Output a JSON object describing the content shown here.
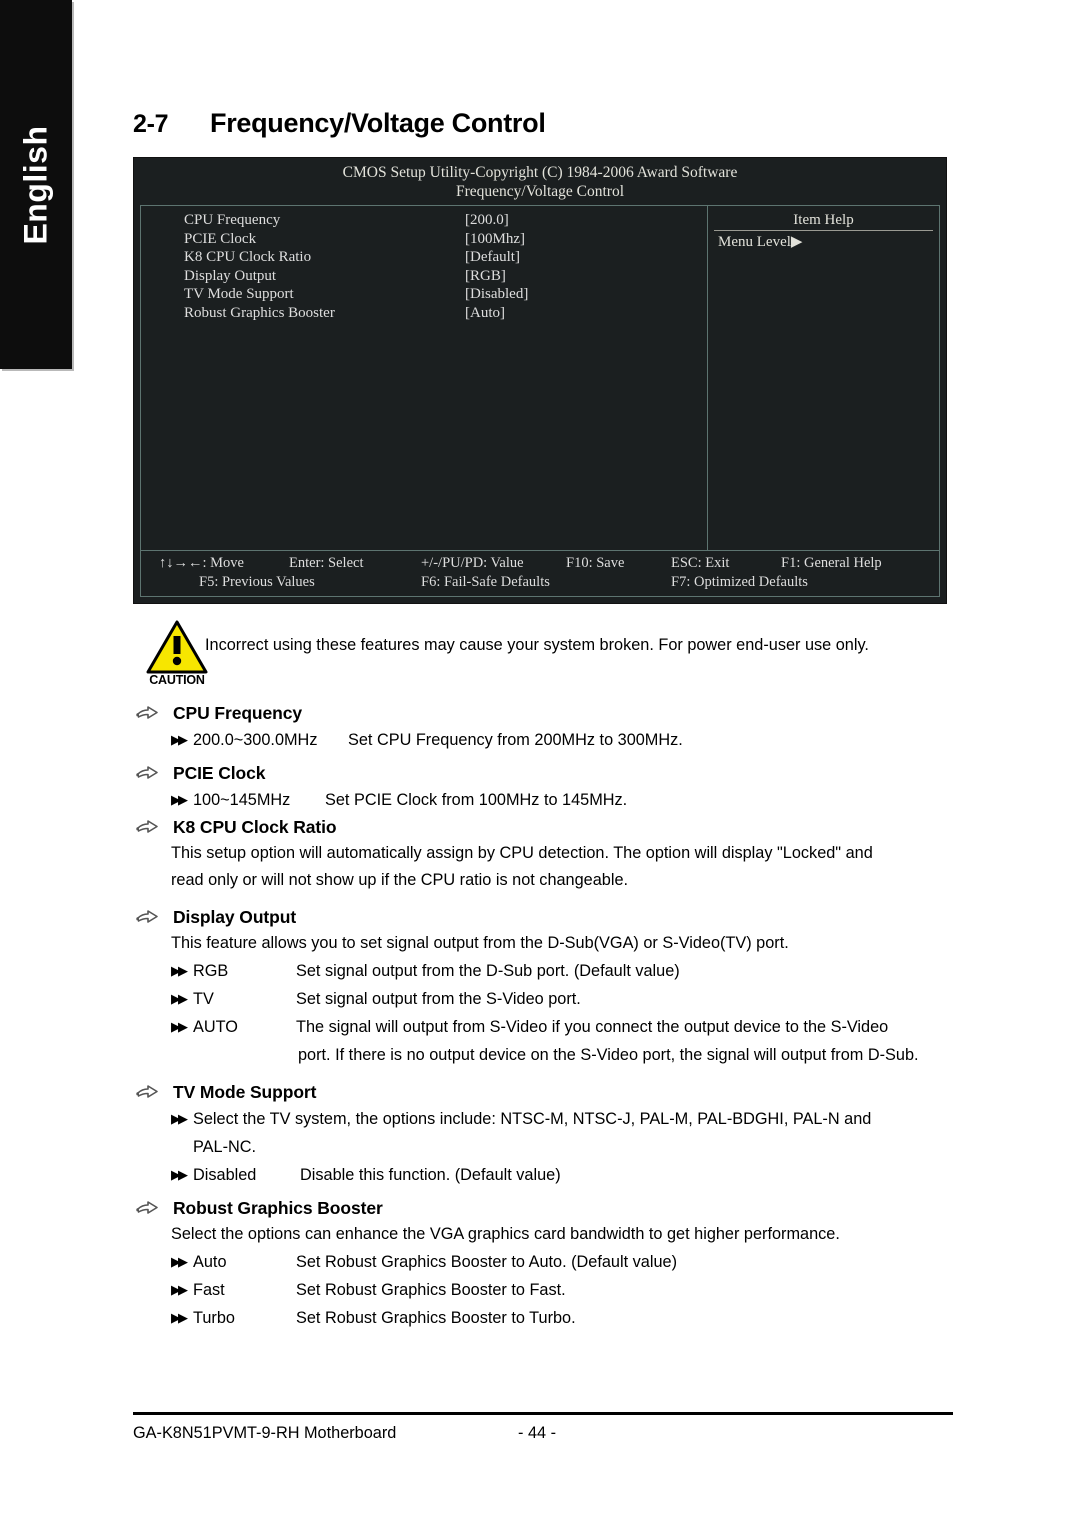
{
  "sidebar": {
    "language_tab": "English"
  },
  "heading": {
    "number": "2-7",
    "title": "Frequency/Voltage Control"
  },
  "bios": {
    "title": "CMOS Setup Utility-Copyright (C) 1984-2006 Award Software",
    "subtitle": "Frequency/Voltage Control",
    "options": [
      {
        "name": "CPU Frequency",
        "value": "[200.0]"
      },
      {
        "name": "PCIE Clock",
        "value": "[100Mhz]"
      },
      {
        "name": "K8 CPU Clock Ratio",
        "value": "[Default]"
      },
      {
        "name": "Display Output",
        "value": "[RGB]"
      },
      {
        "name": "TV Mode Support",
        "value": "[Disabled]"
      },
      {
        "name": "Robust Graphics Booster",
        "value": "[Auto]"
      }
    ],
    "item_help_header": "Item Help",
    "menu_level": "Menu Level▶",
    "keys_row1": [
      "↑↓→←: Move",
      "Enter: Select",
      "+/-/PU/PD: Value",
      "F10: Save",
      "ESC: Exit",
      "F1: General Help"
    ],
    "keys_row2": [
      "F5: Previous Values",
      "F6: Fail-Safe Defaults",
      "F7: Optimized Defaults"
    ]
  },
  "caution": {
    "label": "CAUTION",
    "text": "Incorrect using these features may cause your system broken. For power end-user use only."
  },
  "sections": [
    {
      "title": "CPU Frequency",
      "bullets": [
        {
          "mark": "▶▶",
          "term": "200.0~300.0MHz",
          "desc": "Set CPU Frequency from 200MHz to 300MHz."
        }
      ]
    },
    {
      "title": "PCIE Clock",
      "bullets": [
        {
          "mark": "▶▶",
          "term": "100~145MHz",
          "desc": "Set PCIE Clock from 100MHz to 145MHz."
        }
      ]
    },
    {
      "title": "K8 CPU Clock Ratio",
      "paragraphs": [
        "This setup option will automatically assign by CPU detection. The option will display \"Locked\" and",
        "read only or will not show up if the CPU ratio is not changeable."
      ]
    },
    {
      "title": "Display Output",
      "paragraphs": [
        "This feature allows you to set signal output from the D-Sub(VGA) or S-Video(TV) port."
      ],
      "bullets": [
        {
          "mark": "▶▶",
          "term": "RGB",
          "desc": "Set signal output from the D-Sub port. (Default value)"
        },
        {
          "mark": "▶▶",
          "term": "TV",
          "desc": "Set signal output from the S-Video port."
        },
        {
          "mark": "▶▶",
          "term": "AUTO",
          "desc": "The signal will output from S-Video if you connect the output device to the S-Video",
          "cont": "port. If there is no output device on the S-Video port, the signal will output from D-Sub."
        }
      ]
    },
    {
      "title": "TV Mode Support",
      "bullets": [
        {
          "mark": "▶▶",
          "full": "Select the TV system, the options include: NTSC-M, NTSC-J, PAL-M, PAL-BDGHI, PAL-N and",
          "cont": "PAL-NC."
        },
        {
          "mark": "▶▶",
          "term": "Disabled",
          "desc": "Disable this function. (Default value)"
        }
      ]
    },
    {
      "title": "Robust Graphics Booster",
      "paragraphs": [
        "Select the options can enhance the VGA graphics card bandwidth to get higher performance."
      ],
      "bullets": [
        {
          "mark": "▶▶",
          "term": "Auto",
          "desc": "Set Robust Graphics Booster to Auto. (Default value)"
        },
        {
          "mark": "▶▶",
          "term": "Fast",
          "desc": "Set Robust Graphics Booster to Fast."
        },
        {
          "mark": "▶▶",
          "term": "Turbo",
          "desc": "Set Robust Graphics Booster to Turbo."
        }
      ]
    }
  ],
  "footer": {
    "product": "GA-K8N51PVMT-9-RH Motherboard",
    "page": "- 44 -"
  }
}
